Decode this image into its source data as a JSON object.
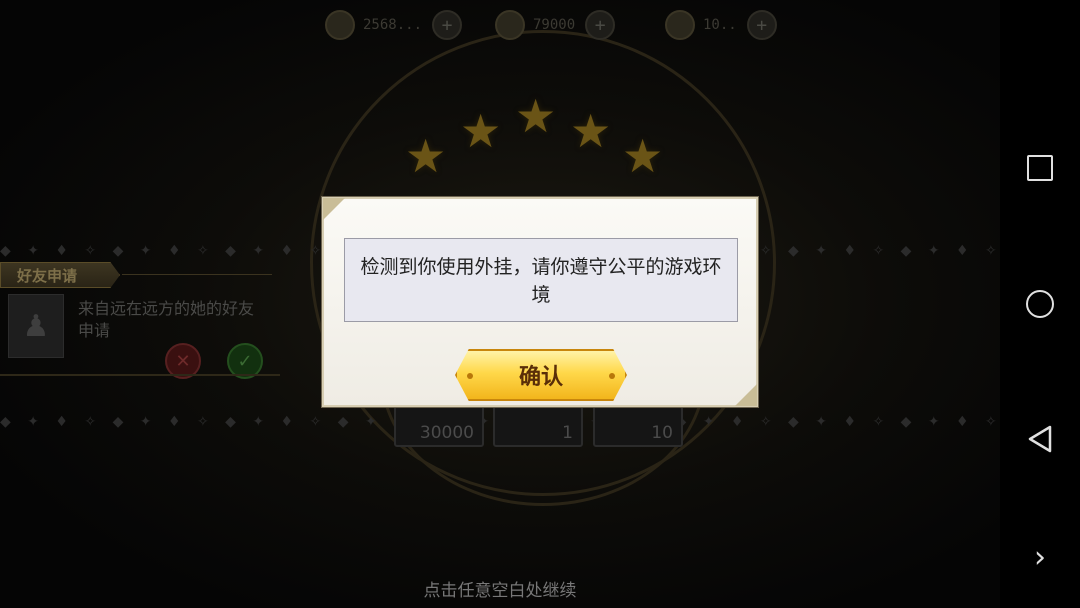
{
  "top_bar": {
    "resources": [
      {
        "icon": "coin-icon",
        "value": "2568..."
      },
      {
        "icon": "energy-icon",
        "value": "79000"
      },
      {
        "icon": "gem-icon",
        "value": "10.."
      }
    ]
  },
  "friend_request": {
    "title": "好友申请",
    "message": "来自远在远方的她的好友申请",
    "reject_icon": "close-icon",
    "accept_icon": "check-icon"
  },
  "rewards": [
    {
      "icon": "crystal-icon",
      "count": "30000"
    },
    {
      "icon": "sword-icon",
      "count": "1"
    },
    {
      "icon": "medal-icon",
      "count": "10"
    }
  ],
  "continue_hint": "点击任意空白处继续",
  "dialog": {
    "message": "检测到你使用外挂，请你遵守公平的游戏环境",
    "confirm_label": "确认"
  },
  "colors": {
    "button_gold": "#ffd84a",
    "dialog_bg": "#fbfaf6",
    "message_bg": "#e8e8f0"
  }
}
